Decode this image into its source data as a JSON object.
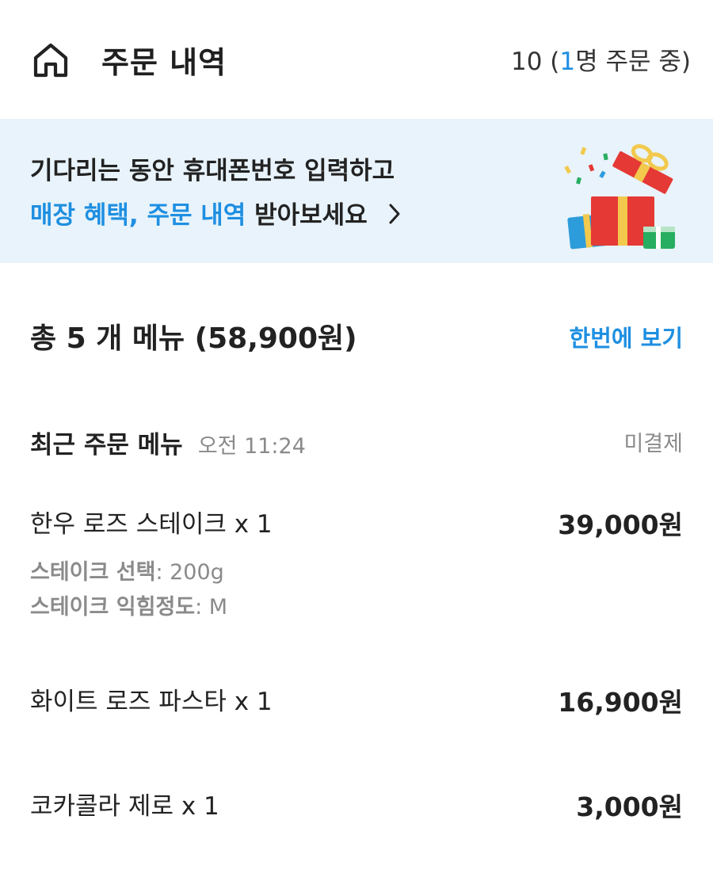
{
  "header": {
    "title": "주문 내역",
    "table_number": "10",
    "status_open": " (",
    "status_count": "1",
    "status_text": "명 주문 중)"
  },
  "banner": {
    "line1": "기다리는 동안 휴대폰번호 입력하고",
    "line2_highlight": "매장 혜택, 주문 내역",
    "line2_rest": " 받아보세요"
  },
  "summary": {
    "text": "총 5 개 메뉴 (58,900원)",
    "view_all_label": "한번에 보기"
  },
  "recent": {
    "title": "최근 주문 메뉴",
    "time": "오전 11:24",
    "payment_status": "미결제"
  },
  "items": [
    {
      "name": "한우 로즈 스테이크 x 1",
      "price": "39,000원",
      "options": [
        {
          "label": "스테이크 선택",
          "value": ": 200g"
        },
        {
          "label": "스테이크 익힘정도",
          "value": ": M"
        }
      ]
    },
    {
      "name": "화이트 로즈 파스타 x 1",
      "price": "16,900원"
    },
    {
      "name": "코카콜라 제로 x 1",
      "price": "3,000원"
    }
  ],
  "icons": {
    "home": "home-icon",
    "chevron": "chevron-right-icon",
    "gift": "gift-box-icon"
  },
  "colors": {
    "accent": "#1e8fe1",
    "banner_bg": "#e8f3fb",
    "muted_text": "#8a8a8a"
  }
}
